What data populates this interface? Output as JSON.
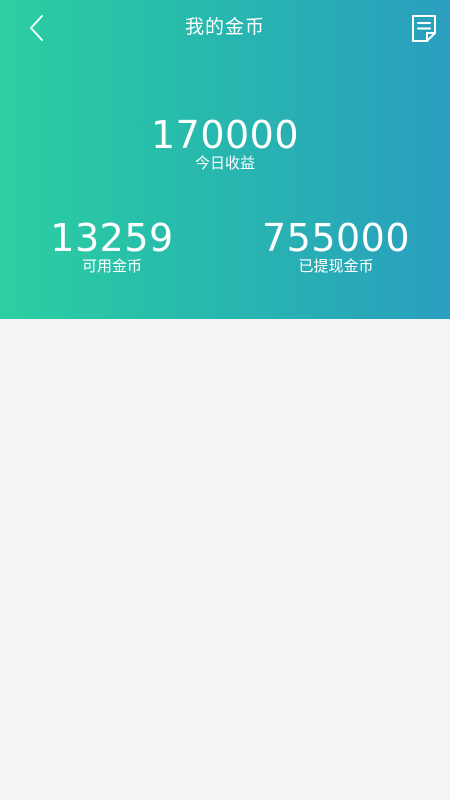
{
  "nav": {
    "title": "我的金币",
    "back_icon": "chevron-left-icon",
    "record_icon": "record-list-icon"
  },
  "stats": {
    "today": {
      "value": "170000",
      "label": "今日收益"
    },
    "available": {
      "value": "13259",
      "label": "可用金币"
    },
    "withdrawn": {
      "value": "755000",
      "label": "已提现金币"
    }
  },
  "colors": {
    "gradient_start": "#2ccfa1",
    "gradient_end": "#2a9fbf",
    "background": "#f4f4f4",
    "text": "#ffffff"
  }
}
